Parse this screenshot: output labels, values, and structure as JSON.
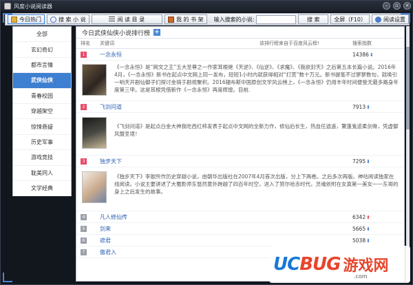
{
  "window": {
    "title": "风度小说阅读器"
  },
  "toolbar": {
    "tabs": [
      {
        "label": "今日热门",
        "icon": "book-icon"
      },
      {
        "label": "搜 索 小 说",
        "icon": "search-icon"
      },
      {
        "label": "阅 读 目 录",
        "icon": "list-icon"
      },
      {
        "label": "我 的 书 架",
        "icon": "bookshelf-icon"
      }
    ],
    "search_label": "输入搜索的小说:",
    "search_value": "",
    "search_button": "搜 索",
    "fullscreen_button": "全屏（F10）",
    "settings_button": "阅读设置"
  },
  "sidebar": {
    "items": [
      "全部",
      "玄幻奇幻",
      "都市言情",
      "武侠仙侠",
      "青春校园",
      "穿越架空",
      "惊悚悬疑",
      "历史军事",
      "游戏竞技",
      "耽美同人",
      "文学经典"
    ],
    "active_index": 3
  },
  "main": {
    "title": "今日武侠仙侠小说排行榜",
    "columns": {
      "rank": "排名",
      "keyword": "关键词",
      "source": "该排行榜来自于百度风云榜!",
      "index": "搜索指数"
    },
    "books": [
      {
        "rank": "1",
        "name": "一念永恒",
        "score": "14386",
        "trend": "down",
        "desc": "《一念永恒》是“网文之王”五大至尊之一作家耳根继《天逆》、《仙逆》、《求魔》、《我欲封天》之后第五本长篇小说。2016年4月，《一念永恒》新书在起点中文网上同一发布，短短1小时内就获得相对“打赏”数十万元。新书提笔不过寥寥数句，就唤引一响天开剧仙御子们探讨金骑于剧视聚积。2016辐布斯中国原创文学风云榜上，《一念永恒》仍用丰年时间便登无最多路身年度第三甲。这是耳根凭借新作《一念永恒》再度辉煌。目前."
      },
      {
        "rank": "2",
        "name": "飞剑问道",
        "score": "7913",
        "trend": "down",
        "desc": "《飞剑问道》是起点白金大神我吃西红柿发表于起点中文网的全新力作，修仙后长生，热血任逍遥，驚蓬鬼迹柔剑骨，凭虚御风盟圣境！"
      },
      {
        "rank": "3",
        "name": "独步天下",
        "score": "7295",
        "trend": "down",
        "desc": "《独步天下》李歆所作历史穿越小说，由朝华出版社在2007年4月首次出版，分上下两卷。之后多次再版。神咕阅读独家在线阅读。小说主要讲述了大蜀影师东悠然意外跨越了四百年时空，进入了努尔哈赤时代，灵魂依附在女真第一美女一一东哥的身上之后发生的故事。"
      },
      {
        "rank": "4",
        "name": "凡人修仙传",
        "score": "6342",
        "trend": "up"
      },
      {
        "rank": "5",
        "name": "剑来",
        "score": "5665",
        "trend": "down"
      },
      {
        "rank": "6",
        "name": "遮君",
        "score": "5038",
        "trend": "down"
      },
      {
        "rank": "7",
        "name": "傲君入",
        "score": "",
        "trend": ""
      }
    ]
  },
  "watermark": {
    "logo_left": "UC",
    "logo_right": "BUG",
    "cn": "游戏网",
    "url": ".com"
  },
  "colors": {
    "accent": "#3d7fd0",
    "rank_top": "#e94b6a",
    "link": "#2b5fb0"
  }
}
